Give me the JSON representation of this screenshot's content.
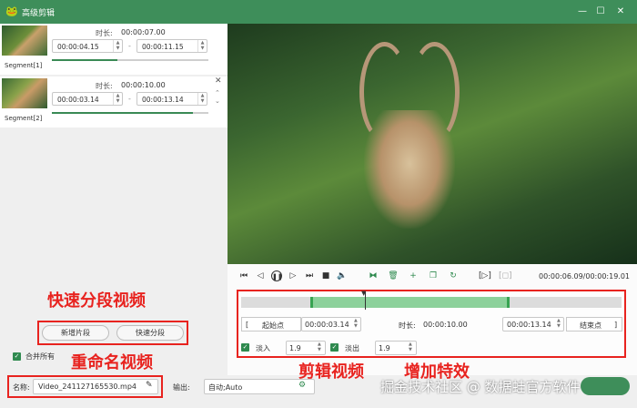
{
  "window": {
    "title": "高级剪辑",
    "minimize": "—",
    "maximize": "☐",
    "close": "✕"
  },
  "segments": [
    {
      "label": "Segment[1]",
      "duration_label": "时长:",
      "duration": "00:00:07.00",
      "start": "00:00:04.15",
      "end": "00:00:11.15",
      "progress": 0.42
    },
    {
      "label": "Segment[2]",
      "duration_label": "时长:",
      "duration": "00:00:10.00",
      "start": "00:00:03.14",
      "end": "00:00:13.14",
      "progress": 0.9
    }
  ],
  "segment_dash": "-",
  "annotations": {
    "quick_split": "快速分段视频",
    "rename": "重命名视频",
    "cut": "剪辑视频",
    "effects": "增加特效"
  },
  "buttons": {
    "add_segment": "新增片段",
    "quick_split": "快速分段",
    "merge_all": "合并所有"
  },
  "playback": {
    "time_readout": "00:00:06.09/00:00:19.01"
  },
  "trim": {
    "start_label": "起始点",
    "start_value": "00:00:03.14",
    "duration_label": "时长:",
    "duration_value": "00:00:10.00",
    "end_value": "00:00:13.14",
    "end_label": "结束点",
    "fade_in_label": "淡入",
    "fade_in_value": "1.9",
    "fade_out_label": "淡出",
    "fade_out_value": "1.9"
  },
  "footer": {
    "name_label": "名称:",
    "name_value": "Video_241127165530.mp4",
    "output_label": "输出:",
    "output_value": "自动;Auto"
  },
  "watermark": "掘金技术社区 @ 数据蛙官方软件"
}
